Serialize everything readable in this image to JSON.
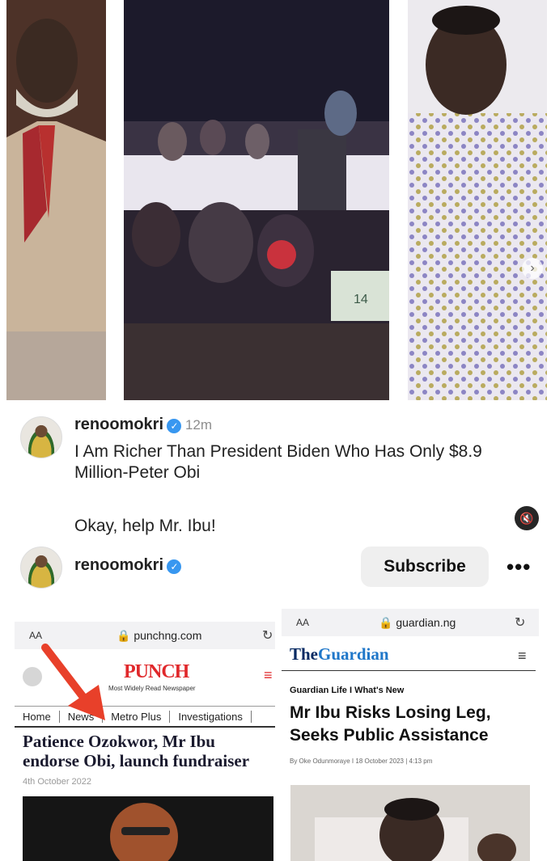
{
  "post": {
    "username": "renoomokri",
    "time": "12m",
    "caption_line1": "I Am Richer Than President Biden Who Has Only $8.9",
    "caption_line2": "Million-Peter Obi",
    "caption_line3": "Okay, help Mr. Ibu!"
  },
  "footer": {
    "username": "renoomokri",
    "subscribe_label": "Subscribe",
    "more_label": "•••"
  },
  "left_shot": {
    "aa_label": "AA",
    "url": "punchng.com",
    "logo": "PUNCH",
    "tagline": "Most Widely Read Newspaper",
    "nav": [
      "Home",
      "News",
      "Metro Plus",
      "Investigations"
    ],
    "headline": "Patience Ozokwor, Mr Ibu endorse Obi, launch fundraiser",
    "date": "4th October 2022"
  },
  "right_shot": {
    "aa_label": "AA",
    "url": "guardian.ng",
    "logo_pre": "The",
    "logo_main": "Guardian",
    "kicker": "Guardian Life  I  What's New",
    "headline": "Mr Ibu Risks Losing Leg, Seeks Public Assistance",
    "byline": "By Oke Odunmoraye  I  18 October 2023  |  4:13 pm"
  },
  "colors": {
    "verified": "#3897f0",
    "punch_red": "#e0282b",
    "guardian_navy": "#052962",
    "arrow": "#e8402a"
  }
}
